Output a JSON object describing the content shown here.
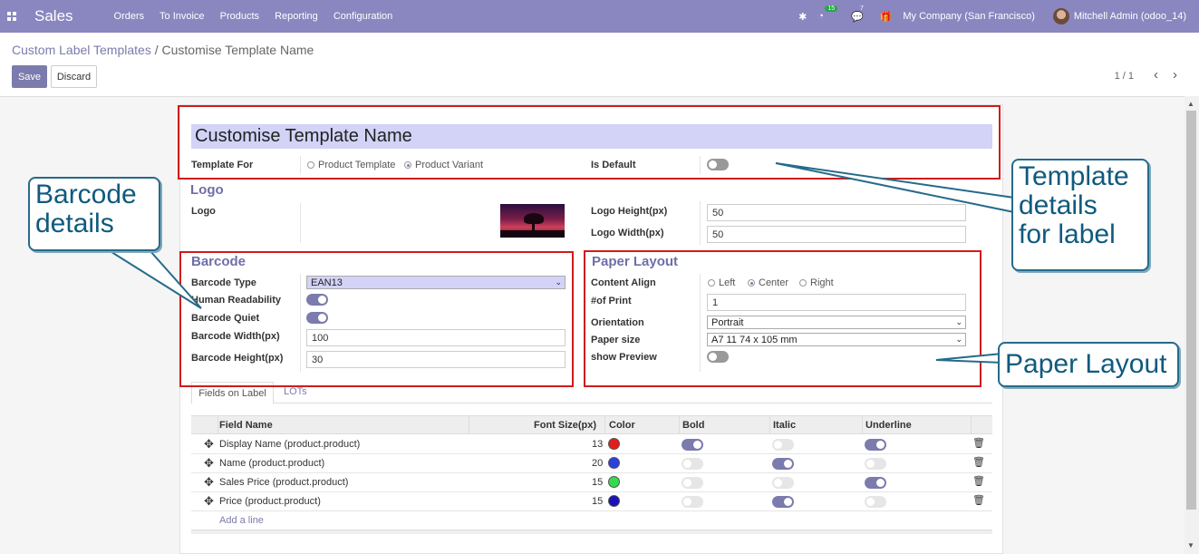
{
  "navbar": {
    "app_name": "Sales",
    "menu": [
      "Orders",
      "To Invoice",
      "Products",
      "Reporting",
      "Configuration"
    ],
    "activity_count": "15",
    "message_count": "7",
    "company": "My Company (San Francisco)",
    "user": "Mitchell Admin (odoo_14)"
  },
  "breadcrumb": {
    "parent": "Custom Label Templates",
    "separator": " / ",
    "current": "Customise Template Name"
  },
  "buttons": {
    "save": "Save",
    "discard": "Discard"
  },
  "pager": {
    "text": "1 / 1",
    "prev": "‹",
    "next": "›"
  },
  "form": {
    "name": "Customise Template Name",
    "template_for_label": "Template For",
    "template_for_options": [
      "Product Template",
      "Product Variant"
    ],
    "template_for_selected": "Product Variant",
    "is_default_label": "Is Default",
    "is_default": false,
    "logo_section": "Logo",
    "logo_label": "Logo",
    "logo_height_label": "Logo Height(px)",
    "logo_height": "50",
    "logo_width_label": "Logo Width(px)",
    "logo_width": "50",
    "barcode_section": "Barcode",
    "barcode_type_label": "Barcode Type",
    "barcode_type": "EAN13",
    "human_readability_label": "Human Readability",
    "human_readability": true,
    "barcode_quiet_label": "Barcode Quiet",
    "barcode_quiet": true,
    "barcode_width_label": "Barcode Width(px)",
    "barcode_width": "100",
    "barcode_height_label": "Barcode Height(px)",
    "barcode_height": "30",
    "paper_section": "Paper Layout",
    "content_align_label": "Content Align",
    "content_align_options": [
      "Left",
      "Center",
      "Right"
    ],
    "content_align_selected": "Center",
    "num_print_label": "#of Print",
    "num_print": "1",
    "orientation_label": "Orientation",
    "orientation": "Portrait",
    "paper_size_label": "Paper size",
    "paper_size": "A7 11 74 x 105 mm",
    "show_preview_label": "show Preview",
    "show_preview": false
  },
  "tabs": {
    "active": "Fields on Label",
    "other": "LOTs"
  },
  "table": {
    "headers": {
      "field": "Field Name",
      "font": "Font Size(px)",
      "color": "Color",
      "bold": "Bold",
      "italic": "Italic",
      "underline": "Underline"
    },
    "rows": [
      {
        "field": "Display Name (product.product)",
        "font": "13",
        "color": "#e51c1c",
        "bold": true,
        "italic": false,
        "underline": true
      },
      {
        "field": "Name (product.product)",
        "font": "20",
        "color": "#2c3fe0",
        "bold": false,
        "italic": true,
        "underline": false
      },
      {
        "field": "Sales Price (product.product)",
        "font": "15",
        "color": "#36d94a",
        "bold": false,
        "italic": false,
        "underline": true
      },
      {
        "field": "Price (product.product)",
        "font": "15",
        "color": "#1a12b8",
        "bold": false,
        "italic": true,
        "underline": false
      }
    ],
    "add_line": "Add a line"
  },
  "callouts": {
    "barcode": [
      "Barcode",
      "details"
    ],
    "template": [
      "Template",
      "details",
      "for label"
    ],
    "paper": "Paper Layout"
  },
  "colors": {
    "navbar": "#8a86c0",
    "primary": "#7c7bad",
    "annotation_red": "#d01c1c",
    "callout_blue": "#256b8b"
  }
}
